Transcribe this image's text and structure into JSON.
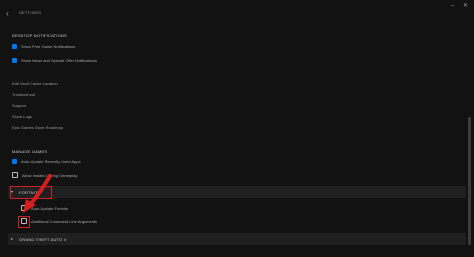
{
  "window": {
    "title": "SETTINGS",
    "back_icon": "chevron-left-icon",
    "minimize_glyph": "–",
    "close_glyph": "✕"
  },
  "desktop_notifications": {
    "header": "DESKTOP NOTIFICATIONS",
    "items": [
      {
        "label": "Show Free Game Notifications",
        "checked": true
      },
      {
        "label": "Show News and Special Offer Notifications",
        "checked": true
      }
    ]
  },
  "links": [
    "Edit Vault Cache Location",
    "Troubleshoot",
    "Support",
    "Show Logs",
    "Epic Games Store Roadmap"
  ],
  "manage_games": {
    "header": "MANAGE GAMES",
    "items": [
      {
        "label": "Auto-Update Recently Used Apps",
        "checked": true
      },
      {
        "label": "Allow Installs During Gameplay",
        "checked": false
      }
    ],
    "games": [
      {
        "name": "FORTNITE",
        "expanded": true,
        "options": [
          {
            "label": "Auto-Update Fortnite",
            "checked": false
          },
          {
            "label": "Additional Command Line Arguments",
            "checked": false
          }
        ]
      },
      {
        "name": "GRAND THEFT AUTO V",
        "expanded": false
      }
    ]
  },
  "colors": {
    "background": "#121212",
    "checkbox_checked": "#0078f2",
    "highlight": "#d21f1f",
    "row_background": "#202020"
  }
}
